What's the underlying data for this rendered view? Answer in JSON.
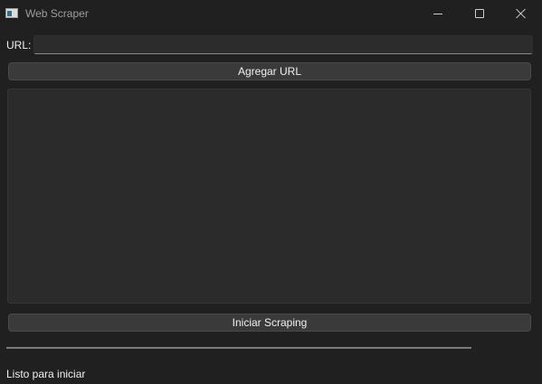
{
  "window": {
    "title": "Web Scraper",
    "icon": "app-window-icon"
  },
  "url_form": {
    "label": "URL:",
    "value": "",
    "placeholder": ""
  },
  "buttons": {
    "add_url": "Agregar URL",
    "start_scraping": "Iniciar Scraping"
  },
  "url_list": {
    "items": []
  },
  "progress": {
    "value_percent": 0
  },
  "status": {
    "text": "Listo para iniciar"
  }
}
